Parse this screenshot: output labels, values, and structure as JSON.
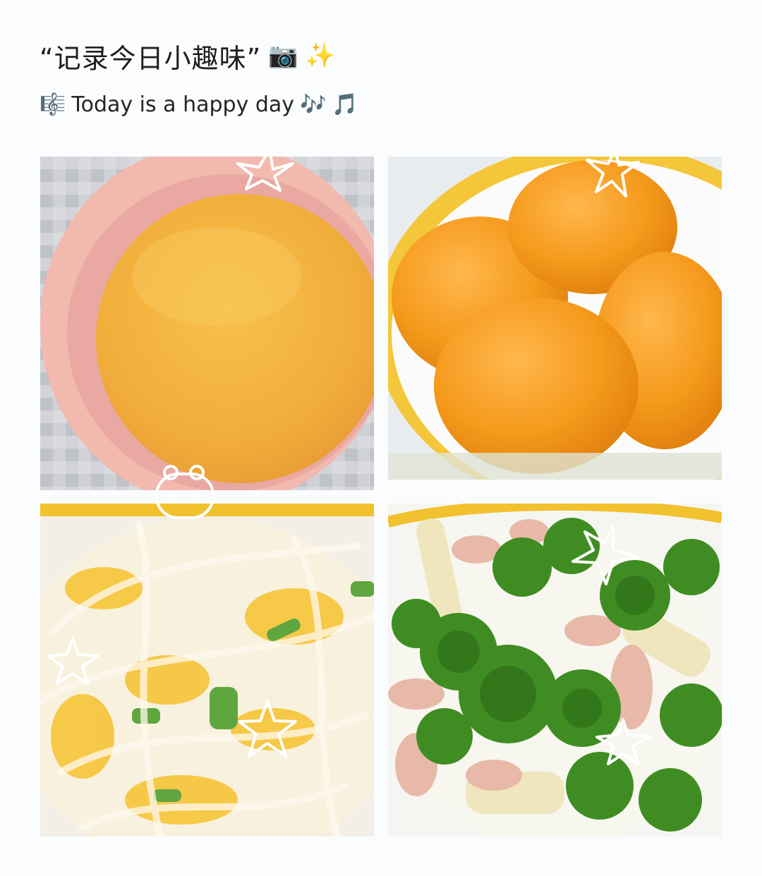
{
  "header": {
    "title": "“记录今日小趣味”",
    "subtitle": "Today is a happy day",
    "icons": [
      "camera-icon",
      "sparkles-icon",
      "musical-score-icon",
      "musical-notes-icon",
      "musical-note-icon"
    ]
  },
  "photos": [
    {
      "name": "millet-porridge-photo"
    },
    {
      "name": "fried-sweet-potato-balls-photo"
    },
    {
      "name": "egg-cabbage-glass-noodles-photo"
    },
    {
      "name": "broccoli-pork-stirfry-photo"
    }
  ],
  "colors": {
    "background": "#fbfcfd",
    "accent_yellow": "#f2c12e",
    "porridge": "#f1b143",
    "sweet_potato": "#f49a1a",
    "broccoli": "#3f8d22"
  }
}
